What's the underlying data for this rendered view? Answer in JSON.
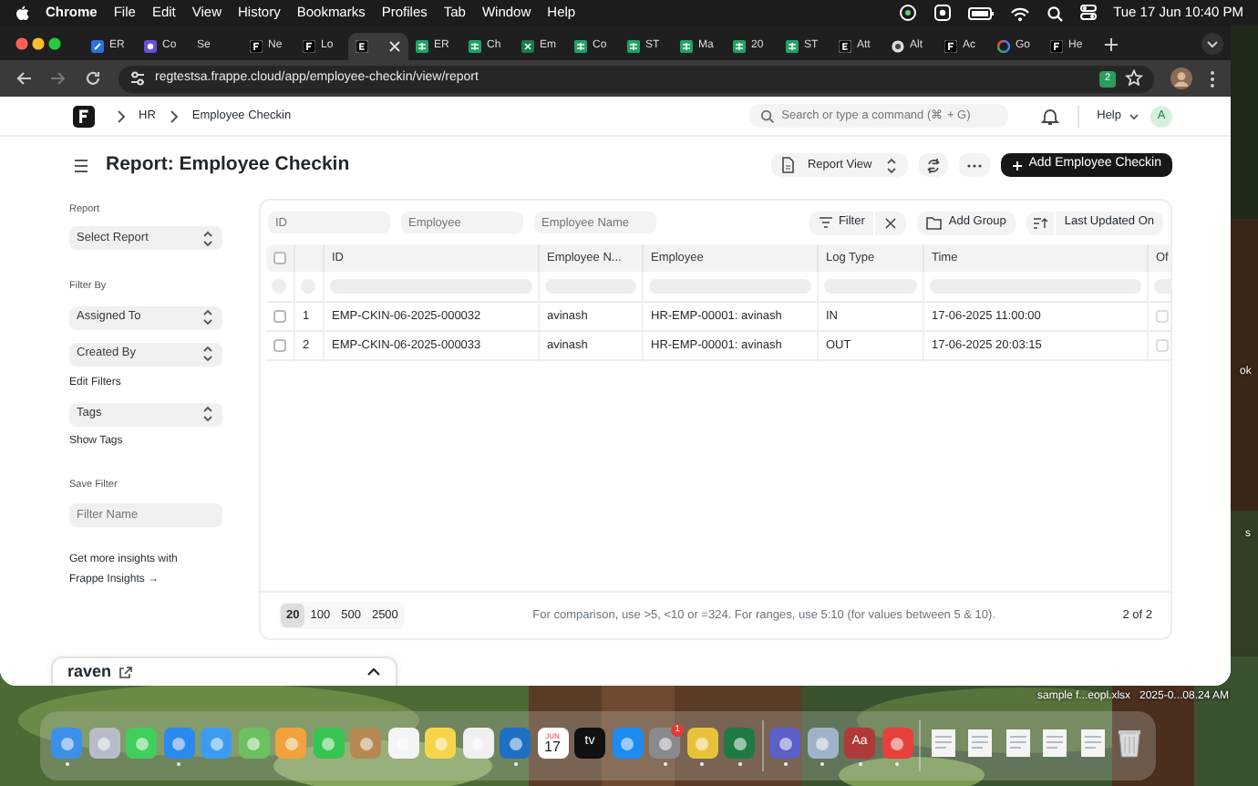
{
  "menubar": {
    "app": "Chrome",
    "menus": [
      "File",
      "Edit",
      "View",
      "History",
      "Bookmarks",
      "Profiles",
      "Tab",
      "Window",
      "Help"
    ],
    "clock": "Tue 17 Jun  10:40 PM"
  },
  "tabs": [
    {
      "title": "ER",
      "kind": "blue",
      "selected": false
    },
    {
      "title": "Co",
      "kind": "purple",
      "selected": false
    },
    {
      "title": "Se",
      "kind": "none",
      "selected": false
    },
    {
      "title": "Ne",
      "kind": "frappe",
      "selected": false
    },
    {
      "title": "Lo",
      "kind": "frappe",
      "selected": false
    },
    {
      "kind": "erp",
      "selected": true
    },
    {
      "title": "ER",
      "kind": "sheets",
      "selected": false
    },
    {
      "title": "Ch",
      "kind": "sheets",
      "selected": false
    },
    {
      "title": "Em",
      "kind": "excel",
      "selected": false
    },
    {
      "title": "Co",
      "kind": "sheets",
      "selected": false
    },
    {
      "title": "ST",
      "kind": "sheets",
      "selected": false
    },
    {
      "title": "Ma",
      "kind": "sheets",
      "selected": false
    },
    {
      "title": "20",
      "kind": "sheets",
      "selected": false
    },
    {
      "title": "ST",
      "kind": "sheets",
      "selected": false
    },
    {
      "title": "Att",
      "kind": "erp",
      "selected": false
    },
    {
      "title": "Alt",
      "kind": "circle",
      "selected": false
    },
    {
      "title": "Ac",
      "kind": "frappe",
      "selected": false
    },
    {
      "title": "Go",
      "kind": "google",
      "selected": false
    },
    {
      "title": "He",
      "kind": "frappe",
      "selected": false
    }
  ],
  "address_bar": {
    "url": "regtestsa.frappe.cloud/app/employee-checkin/view/report",
    "extension_badge": "2"
  },
  "navbar": {
    "breadcrumbs": [
      "HR",
      "Employee Checkin"
    ],
    "search_placeholder": "Search or type a command (⌘ + G)",
    "help": "Help",
    "avatar": "A"
  },
  "page_title": "Report: Employee Checkin",
  "actions": {
    "view": "Report View",
    "primary": "Add Employee Checkin"
  },
  "sidebar": {
    "report_label": "Report",
    "report_select": "Select Report",
    "filter_by_label": "Filter By",
    "filter_selects": [
      "Assigned To",
      "Created By"
    ],
    "edit_filters": "Edit Filters",
    "tags_select": "Tags",
    "show_tags": "Show Tags",
    "save_filter_label": "Save Filter",
    "filter_name_placeholder": "Filter Name",
    "insights_text": "Get more insights with",
    "insights_link": "Frappe Insights →"
  },
  "filters": {
    "field_placeholders": [
      "ID",
      "Employee",
      "Employee Name"
    ],
    "filter_button": "Filter",
    "group_button": "Add Group",
    "sort_button": "Last Updated On"
  },
  "table": {
    "all_checked": false,
    "columns": [
      "ID",
      "Employee N...",
      "Employee",
      "Log Type",
      "Time",
      "Of"
    ],
    "rows": [
      {
        "checked": false,
        "index": "1",
        "id": "EMP-CKIN-06-2025-000032",
        "employee_name": "avinash",
        "employee": "HR-EMP-00001: avinash",
        "log_type": "IN",
        "time": "17-06-2025 11:00:00",
        "column_7": false
      },
      {
        "checked": false,
        "index": "2",
        "id": "EMP-CKIN-06-2025-000033",
        "employee_name": "avinash",
        "employee": "HR-EMP-00001: avinash",
        "log_type": "OUT",
        "time": "17-06-2025 20:03:15",
        "column_7": false
      }
    ]
  },
  "footer": {
    "page_sizes": [
      {
        "label": "20",
        "selected": true
      },
      {
        "label": "100",
        "selected": false
      },
      {
        "label": "500",
        "selected": false
      },
      {
        "label": "2500",
        "selected": false
      }
    ],
    "hint": "For comparison, use >5, <10 or =324. For ranges, use 5:10 (for values between 5 & 10).",
    "count": "2 of 2"
  },
  "raven": {
    "title": "raven"
  },
  "desktop": {
    "labels": [
      "ok",
      "s"
    ],
    "file_name": "sample f...eopl.xlsx",
    "file_date": "2025-0...08.24 AM"
  },
  "dock": [
    {
      "kind": "app",
      "color": "#3d8fe8",
      "running": true
    },
    {
      "kind": "app",
      "color": "#b8bcc8",
      "running": false
    },
    {
      "kind": "app",
      "color": "#3fcf5c",
      "running": false
    },
    {
      "kind": "app",
      "color": "#2a8af0",
      "running": true
    },
    {
      "kind": "app",
      "color": "#3c9cf2",
      "running": false
    },
    {
      "kind": "app",
      "color": "#6cc060",
      "running": false
    },
    {
      "kind": "app",
      "color": "#f2a23c",
      "running": false
    },
    {
      "kind": "app",
      "color": "#36c452",
      "running": false
    },
    {
      "kind": "app",
      "color": "#b58a52",
      "running": false
    },
    {
      "kind": "app",
      "color": "#f4f4f4",
      "running": false
    },
    {
      "kind": "app",
      "color": "#f6d54a",
      "running": false
    },
    {
      "kind": "app",
      "color": "#f0f0f0",
      "running": false
    },
    {
      "kind": "app",
      "color": "#1f6fc5",
      "running": true
    },
    {
      "kind": "calendar",
      "color": "#ffffff",
      "running": false,
      "month": "JUN",
      "day": "17"
    },
    {
      "kind": "app",
      "color": "#111111",
      "running": false,
      "label": "tv"
    },
    {
      "kind": "app",
      "color": "#1d8cf0",
      "running": false
    },
    {
      "kind": "app",
      "color": "#8a8a8e",
      "running": true,
      "badge": "1"
    },
    {
      "kind": "app",
      "color": "#e8c33a",
      "running": true
    },
    {
      "kind": "app",
      "color": "#1d7a44",
      "running": true
    },
    {
      "kind": "divider"
    },
    {
      "kind": "app",
      "color": "#5b5fc7",
      "running": true
    },
    {
      "kind": "app",
      "color": "#9fb3c8",
      "running": true
    },
    {
      "kind": "app",
      "color": "#b03a3a",
      "running": true,
      "label": "Aa"
    },
    {
      "kind": "app",
      "color": "#e8403a",
      "running": true
    },
    {
      "kind": "divider"
    },
    {
      "kind": "document"
    },
    {
      "kind": "document"
    },
    {
      "kind": "document"
    },
    {
      "kind": "document"
    },
    {
      "kind": "document"
    },
    {
      "kind": "trash"
    }
  ]
}
